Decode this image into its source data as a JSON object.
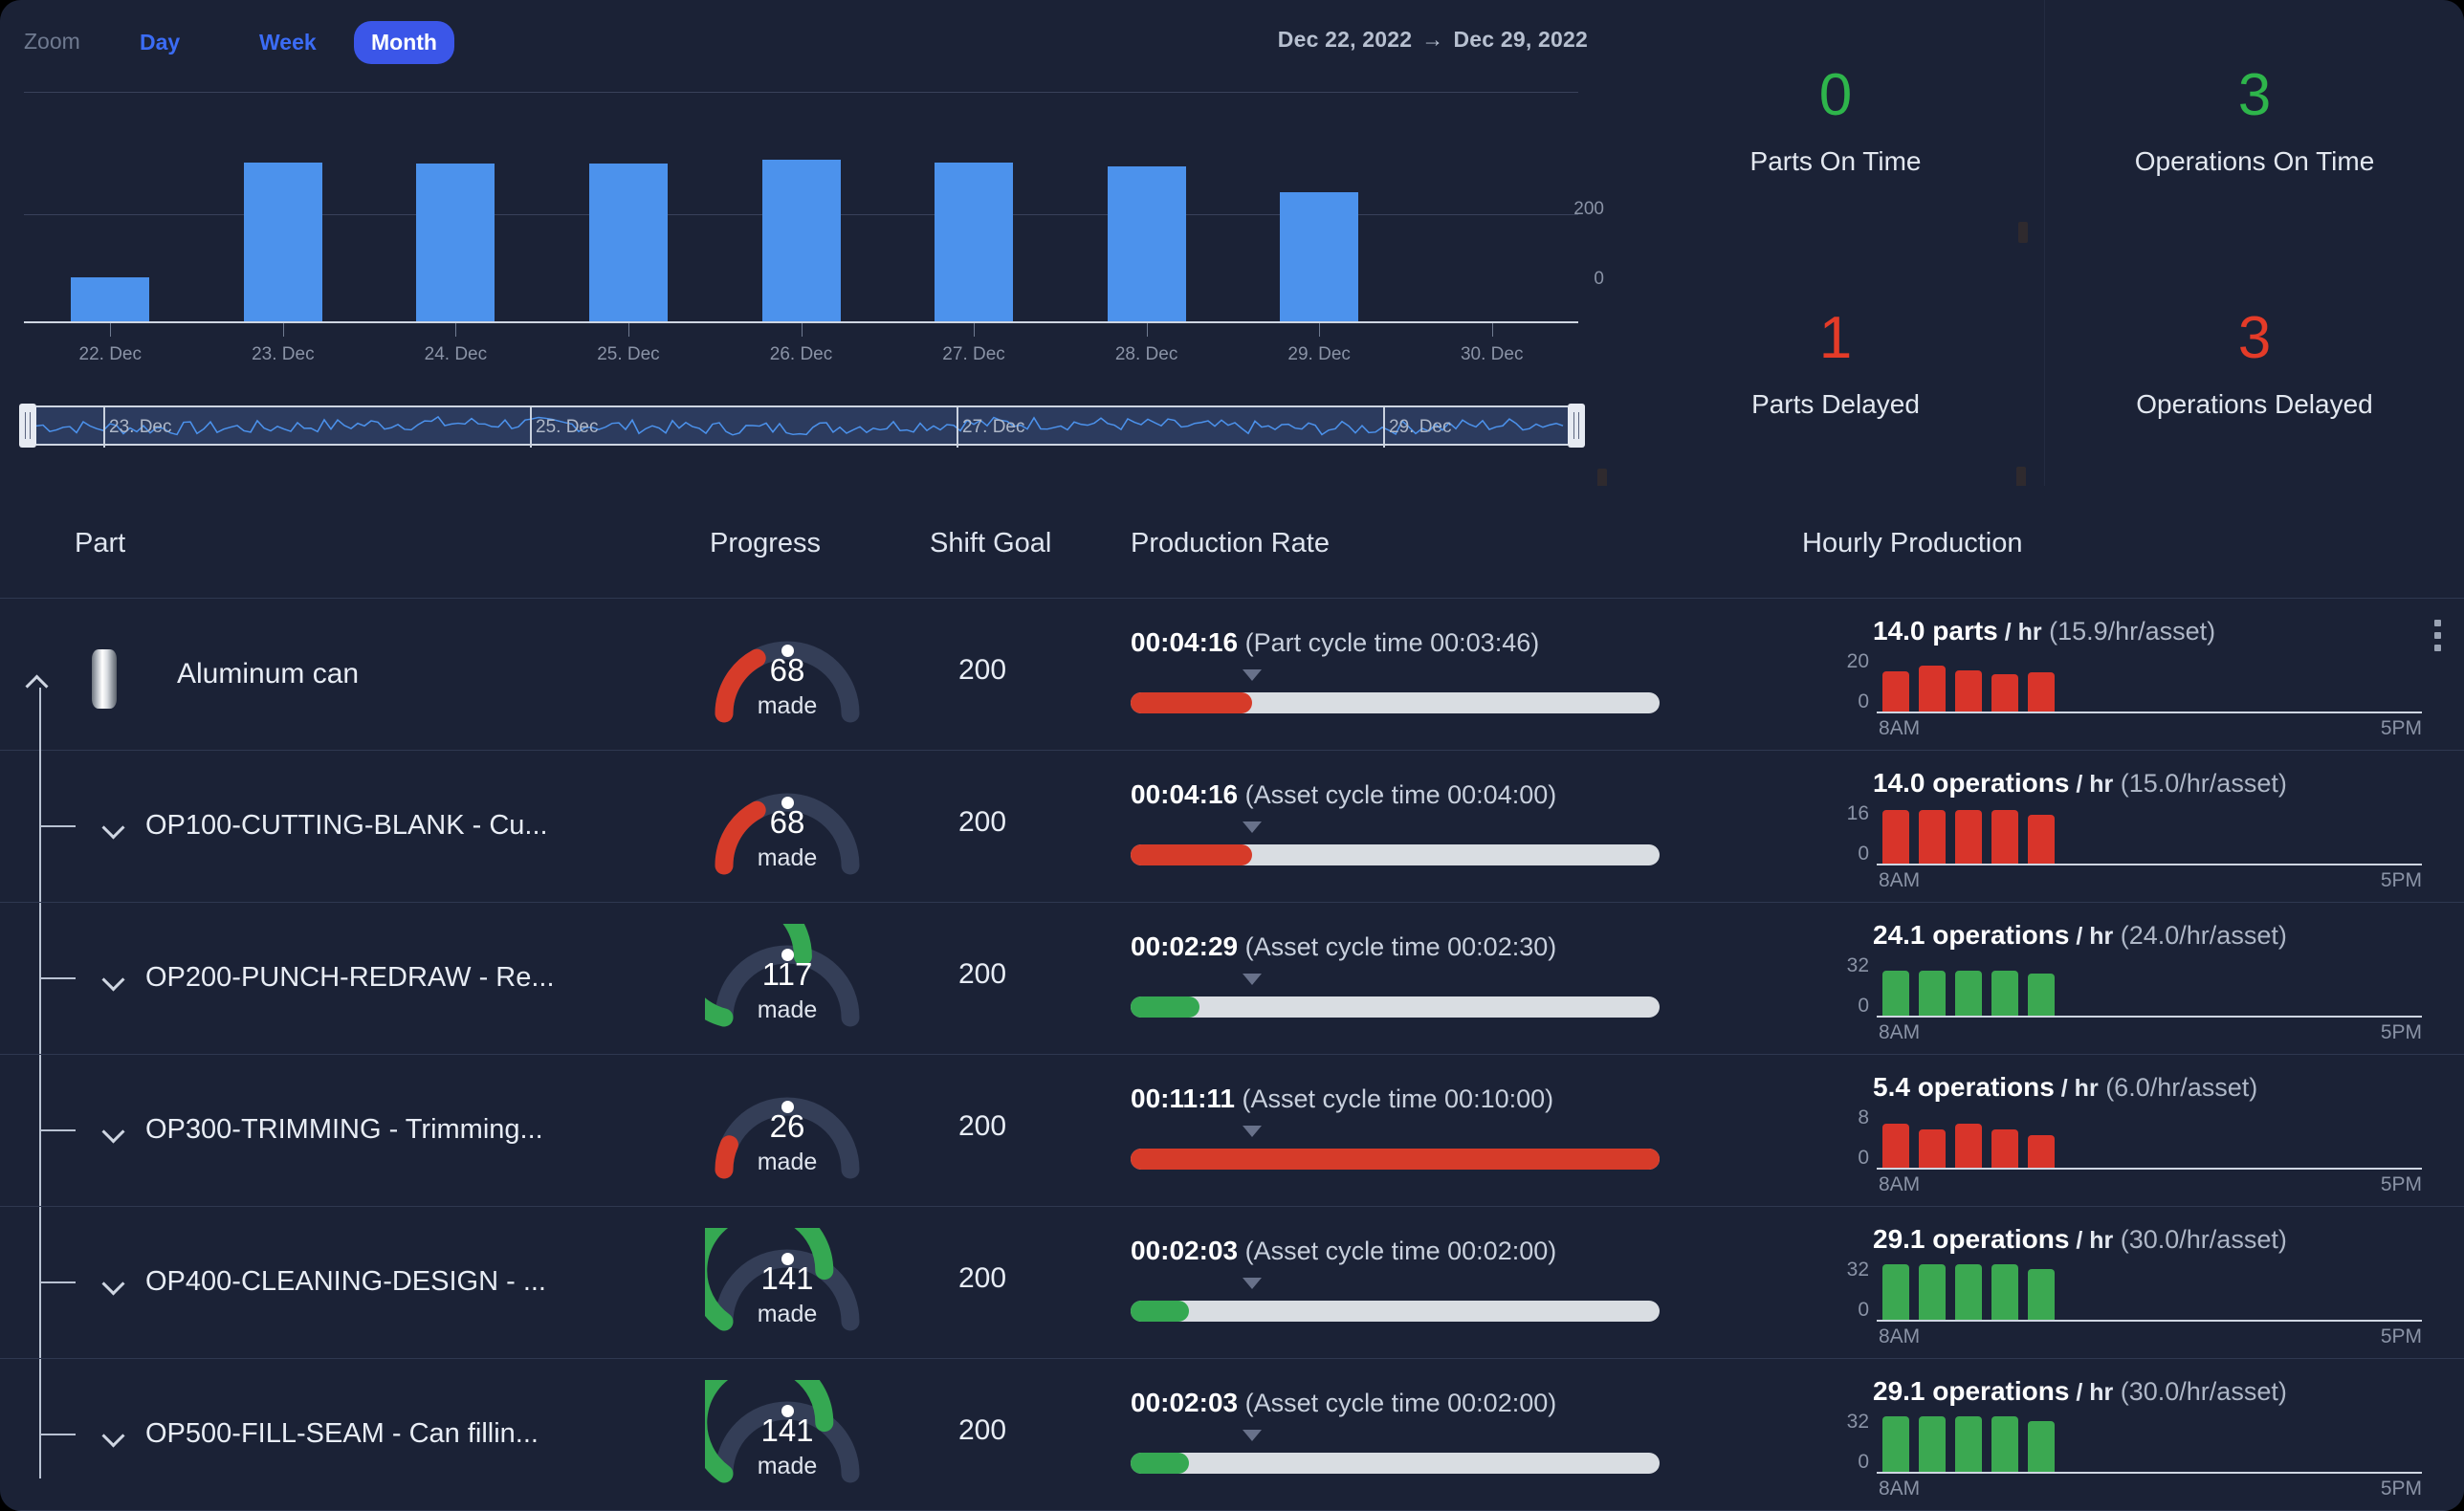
{
  "zoom": {
    "label": "Zoom",
    "options": [
      "Day",
      "Week",
      "Month"
    ],
    "selected": "Month",
    "day": "Day",
    "week": "Week",
    "month": "Month"
  },
  "date_range": {
    "start": "Dec 22, 2022",
    "arrow": "→",
    "end": "Dec 29, 2022"
  },
  "kpis": [
    {
      "value": "0",
      "label": "Parts On Time",
      "color": "#2eb54b"
    },
    {
      "value": "3",
      "label": "Operations On Time",
      "color": "#2eb54b"
    },
    {
      "value": "1",
      "label": "Parts Delayed",
      "color": "#e43b28"
    },
    {
      "value": "3",
      "label": "Operations Delayed",
      "color": "#e43b28"
    }
  ],
  "table": {
    "headers": {
      "part": "Part",
      "progress": "Progress",
      "shift_goal": "Shift Goal",
      "production_rate": "Production Rate",
      "hourly_production": "Hourly Production"
    },
    "rows": [
      {
        "name": "Aluminum can",
        "level": 0,
        "icon": "aluminum-can-icon",
        "expanded": true,
        "gauge": {
          "value": "68",
          "unit": "made",
          "pct": 34,
          "color": "#d63b29",
          "marker_pct": 50
        },
        "shift_goal": "200",
        "rate": {
          "time": "00:04:16",
          "note": "(Part cycle time 00:03:46)",
          "fill_pct": 23,
          "color": "#d63b29",
          "caret_pct": 23
        },
        "hourly": {
          "value": "14.0",
          "unit": "parts",
          "per": "/ hr",
          "asset": "(15.9/hr/asset)",
          "ymax": "20",
          "ymin": "0",
          "xstart": "8AM",
          "xend": "5PM",
          "color": "#d8342a",
          "bars": [
            13.6,
            15.5,
            14.0,
            12.6,
            13.3
          ]
        },
        "kebab": true
      },
      {
        "name": "OP100-CUTTING-BLANK - Cu...",
        "level": 1,
        "expanded": false,
        "gauge": {
          "value": "68",
          "unit": "made",
          "pct": 34,
          "color": "#d63b29",
          "marker_pct": 50
        },
        "shift_goal": "200",
        "rate": {
          "time": "00:04:16",
          "note": "(Asset cycle time 00:04:00)",
          "fill_pct": 23,
          "color": "#d63b29",
          "caret_pct": 23
        },
        "hourly": {
          "value": "14.0",
          "unit": "operations",
          "per": "/ hr",
          "asset": "(15.0/hr/asset)",
          "ymax": "16",
          "ymin": "0",
          "xstart": "8AM",
          "xend": "5PM",
          "color": "#d8342a",
          "bars": [
            14.5,
            14.5,
            14.5,
            14.5,
            13.2
          ]
        },
        "kebab": false
      },
      {
        "name": "OP200-PUNCH-REDRAW - Re...",
        "level": 1,
        "expanded": false,
        "gauge": {
          "value": "117",
          "unit": "made",
          "pct": 58,
          "color": "#35a852",
          "marker_pct": 50
        },
        "shift_goal": "200",
        "rate": {
          "time": "00:02:29",
          "note": "(Asset cycle time 00:02:30)",
          "fill_pct": 13,
          "color": "#35a852",
          "caret_pct": 23
        },
        "hourly": {
          "value": "24.1",
          "unit": "operations",
          "per": "/ hr",
          "asset": "(24.0/hr/asset)",
          "ymax": "32",
          "ymin": "0",
          "xstart": "8AM",
          "xend": "5PM",
          "color": "#3ba851",
          "bars": [
            24.5,
            24.5,
            24.5,
            24.5,
            22.5
          ]
        },
        "kebab": false
      },
      {
        "name": "OP300-TRIMMING - Trimming...",
        "level": 1,
        "expanded": false,
        "gauge": {
          "value": "26",
          "unit": "made",
          "pct": 13,
          "color": "#d63b29",
          "marker_pct": 50
        },
        "shift_goal": "200",
        "rate": {
          "time": "00:11:11",
          "note": "(Asset cycle time 00:10:00)",
          "fill_pct": 100,
          "color": "#d63b29",
          "caret_pct": 23
        },
        "hourly": {
          "value": "5.4",
          "unit": "operations",
          "per": "/ hr",
          "asset": "(6.0/hr/asset)",
          "ymax": "8",
          "ymin": "0",
          "xstart": "8AM",
          "xend": "5PM",
          "color": "#d8342a",
          "bars": [
            5.9,
            5.2,
            6.0,
            5.2,
            4.4
          ]
        },
        "kebab": false
      },
      {
        "name": "OP400-CLEANING-DESIGN - ...",
        "level": 1,
        "expanded": false,
        "gauge": {
          "value": "141",
          "unit": "made",
          "pct": 70,
          "color": "#35a852",
          "marker_pct": 50
        },
        "shift_goal": "200",
        "rate": {
          "time": "00:02:03",
          "note": "(Asset cycle time 00:02:00)",
          "fill_pct": 11,
          "color": "#35a852",
          "caret_pct": 23
        },
        "hourly": {
          "value": "29.1",
          "unit": "operations",
          "per": "/ hr",
          "asset": "(30.0/hr/asset)",
          "ymax": "32",
          "ymin": "0",
          "xstart": "8AM",
          "xend": "5PM",
          "color": "#3ba851",
          "bars": [
            29.8,
            29.8,
            29.8,
            29.8,
            27.5
          ]
        },
        "kebab": false
      },
      {
        "name": "OP500-FILL-SEAM - Can fillin...",
        "level": 1,
        "expanded": false,
        "gauge": {
          "value": "141",
          "unit": "made",
          "pct": 70,
          "color": "#35a852",
          "marker_pct": 50
        },
        "shift_goal": "200",
        "rate": {
          "time": "00:02:03",
          "note": "(Asset cycle time 00:02:00)",
          "fill_pct": 11,
          "color": "#35a852",
          "caret_pct": 23
        },
        "hourly": {
          "value": "29.1",
          "unit": "operations",
          "per": "/ hr",
          "asset": "(30.0/hr/asset)",
          "ymax": "32",
          "ymin": "0",
          "xstart": "8AM",
          "xend": "5PM",
          "color": "#3ba851",
          "bars": [
            29.8,
            29.8,
            29.8,
            29.8,
            27.5
          ]
        },
        "kebab": false
      }
    ]
  },
  "chart_data": {
    "type": "bar",
    "title": "",
    "xlabel": "",
    "ylabel": "",
    "categories": [
      "22. Dec",
      "23. Dec",
      "24. Dec",
      "25. Dec",
      "26. Dec",
      "27. Dec",
      "28. Dec",
      "29. Dec",
      "30. Dec"
    ],
    "values": [
      68,
      247,
      245,
      245,
      250,
      246,
      241,
      200,
      0
    ],
    "ylim": [
      0,
      270
    ],
    "yticks": [
      0,
      200
    ],
    "ytick_labels": [
      "0",
      "200"
    ],
    "bar_color": "#4c92ec",
    "grid": true,
    "legend": "none",
    "navigator": {
      "labels": [
        "23. Dec",
        "25. Dec",
        "27. Dec",
        "29. Dec"
      ],
      "series_color": "#4c92ec",
      "selection_start": "Dec 22, 2022",
      "selection_end": "Dec 29, 2022"
    }
  }
}
